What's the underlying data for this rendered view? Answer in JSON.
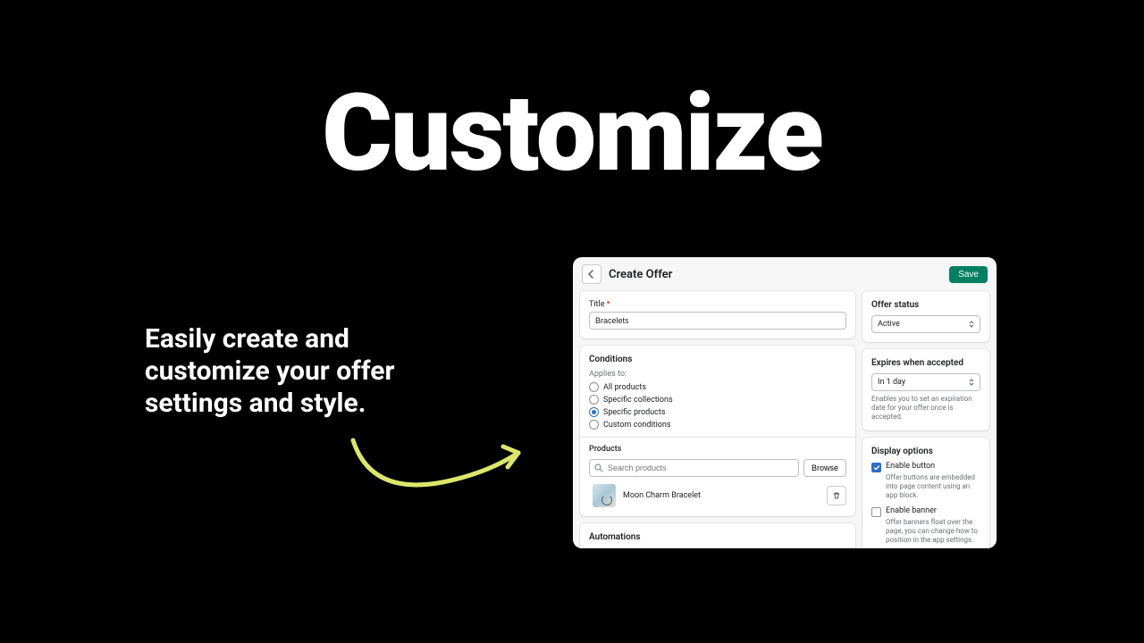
{
  "hero": {
    "headline": "Customize",
    "tagline": "Easily create and customize your offer settings and style."
  },
  "panel": {
    "title": "Create Offer",
    "save": "Save",
    "title_field": {
      "label": "Title",
      "value": "Bracelets"
    },
    "conditions": {
      "heading": "Conditions",
      "applies": "Applies to:",
      "options": [
        "All products",
        "Specific collections",
        "Specific products",
        "Custom conditions"
      ],
      "selected": "Specific products"
    },
    "products": {
      "heading": "Products",
      "placeholder": "Search products",
      "browse": "Browse",
      "item": "Moon Charm Bracelet"
    },
    "automations": "Automations",
    "status": {
      "heading": "Offer status",
      "value": "Active"
    },
    "expires": {
      "heading": "Expires when accepted",
      "value": "In 1 day",
      "help": "Enables you to set an expiration date for your offer once is accepted."
    },
    "display": {
      "heading": "Display options",
      "btn_label": "Enable button",
      "btn_help": "Offer buttons are embedded into page content using an app block.",
      "banner_label": "Enable banner",
      "banner_help": "Offer banners float over the page, you can change how to position in the app settings."
    }
  }
}
